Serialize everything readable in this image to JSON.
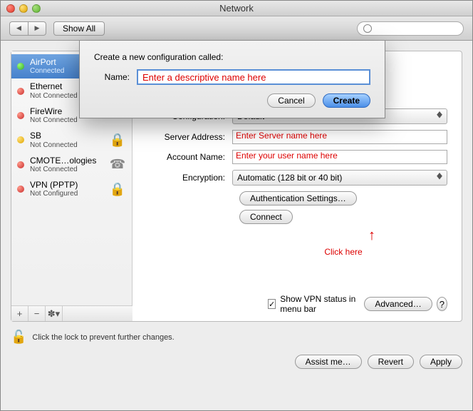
{
  "window": {
    "title": "Network"
  },
  "toolbar": {
    "show_all": "Show All",
    "search_placeholder": "Q"
  },
  "sheet": {
    "prompt": "Create a new configuration called:",
    "name_label": "Name:",
    "name_value": "Enter a descriptive name here",
    "cancel": "Cancel",
    "create": "Create"
  },
  "sidebar": {
    "items": [
      {
        "name": "AirPort",
        "status": "Connected",
        "dot": "green",
        "icon": "wifi"
      },
      {
        "name": "Ethernet",
        "status": "Not Connected",
        "dot": "red",
        "icon": "ethernet"
      },
      {
        "name": "FireWire",
        "status": "Not Connected",
        "dot": "red",
        "icon": "firewire"
      },
      {
        "name": "SB",
        "status": "Not Connected",
        "dot": "yellow",
        "icon": "lock"
      },
      {
        "name": "CMOTE…ologies",
        "status": "Not Connected",
        "dot": "red",
        "icon": "phone"
      },
      {
        "name": "VPN (PPTP)",
        "status": "Not Configured",
        "dot": "red",
        "icon": "lock"
      }
    ]
  },
  "form": {
    "configuration_label": "Configuration:",
    "configuration_value": "Default",
    "server_label": "Server Address:",
    "server_value": "Enter Server name here",
    "account_label": "Account Name:",
    "account_value": "Enter your user name here",
    "encryption_label": "Encryption:",
    "encryption_value": "Automatic (128 bit or 40 bit)",
    "auth_button": "Authentication Settings…",
    "connect_button": "Connect",
    "annotation": "Click here",
    "show_status_label": "Show VPN status in menu bar",
    "show_status_checked": true,
    "advanced": "Advanced…"
  },
  "lock": {
    "text": "Click the lock to prevent further changes."
  },
  "buttons": {
    "assist": "Assist me…",
    "revert": "Revert",
    "apply": "Apply"
  }
}
